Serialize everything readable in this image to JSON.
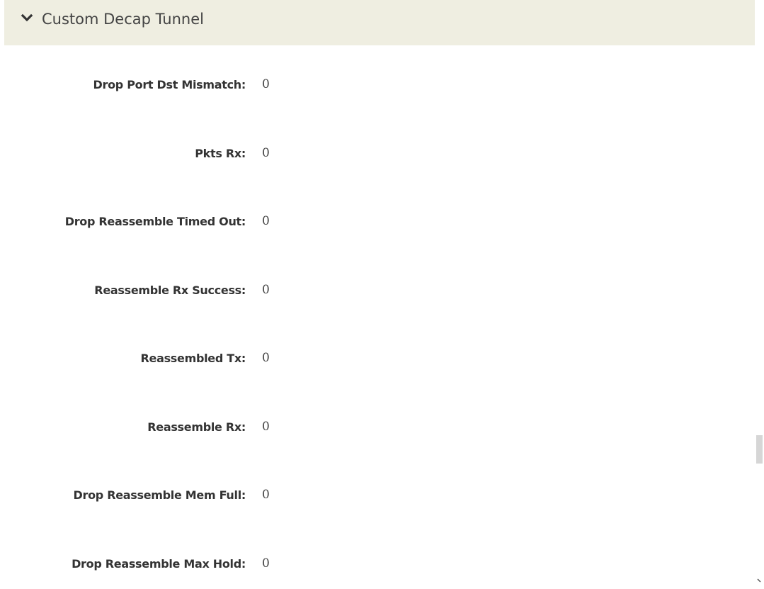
{
  "section": {
    "title": "Custom Decap Tunnel",
    "toggle_icon": "chevron-down-icon",
    "background_color": "#efeee1"
  },
  "stats": [
    {
      "label": "Drop Port Dst Mismatch:",
      "value": "0"
    },
    {
      "label": "Pkts Rx:",
      "value": "0"
    },
    {
      "label": "Drop Reassemble Timed Out:",
      "value": "0"
    },
    {
      "label": "Reassemble Rx Success:",
      "value": "0"
    },
    {
      "label": "Reassembled Tx:",
      "value": "0"
    },
    {
      "label": "Reassemble Rx:",
      "value": "0"
    },
    {
      "label": "Drop Reassemble Mem Full:",
      "value": "0"
    },
    {
      "label": "Drop Reassemble Max Hold:",
      "value": "0"
    }
  ]
}
